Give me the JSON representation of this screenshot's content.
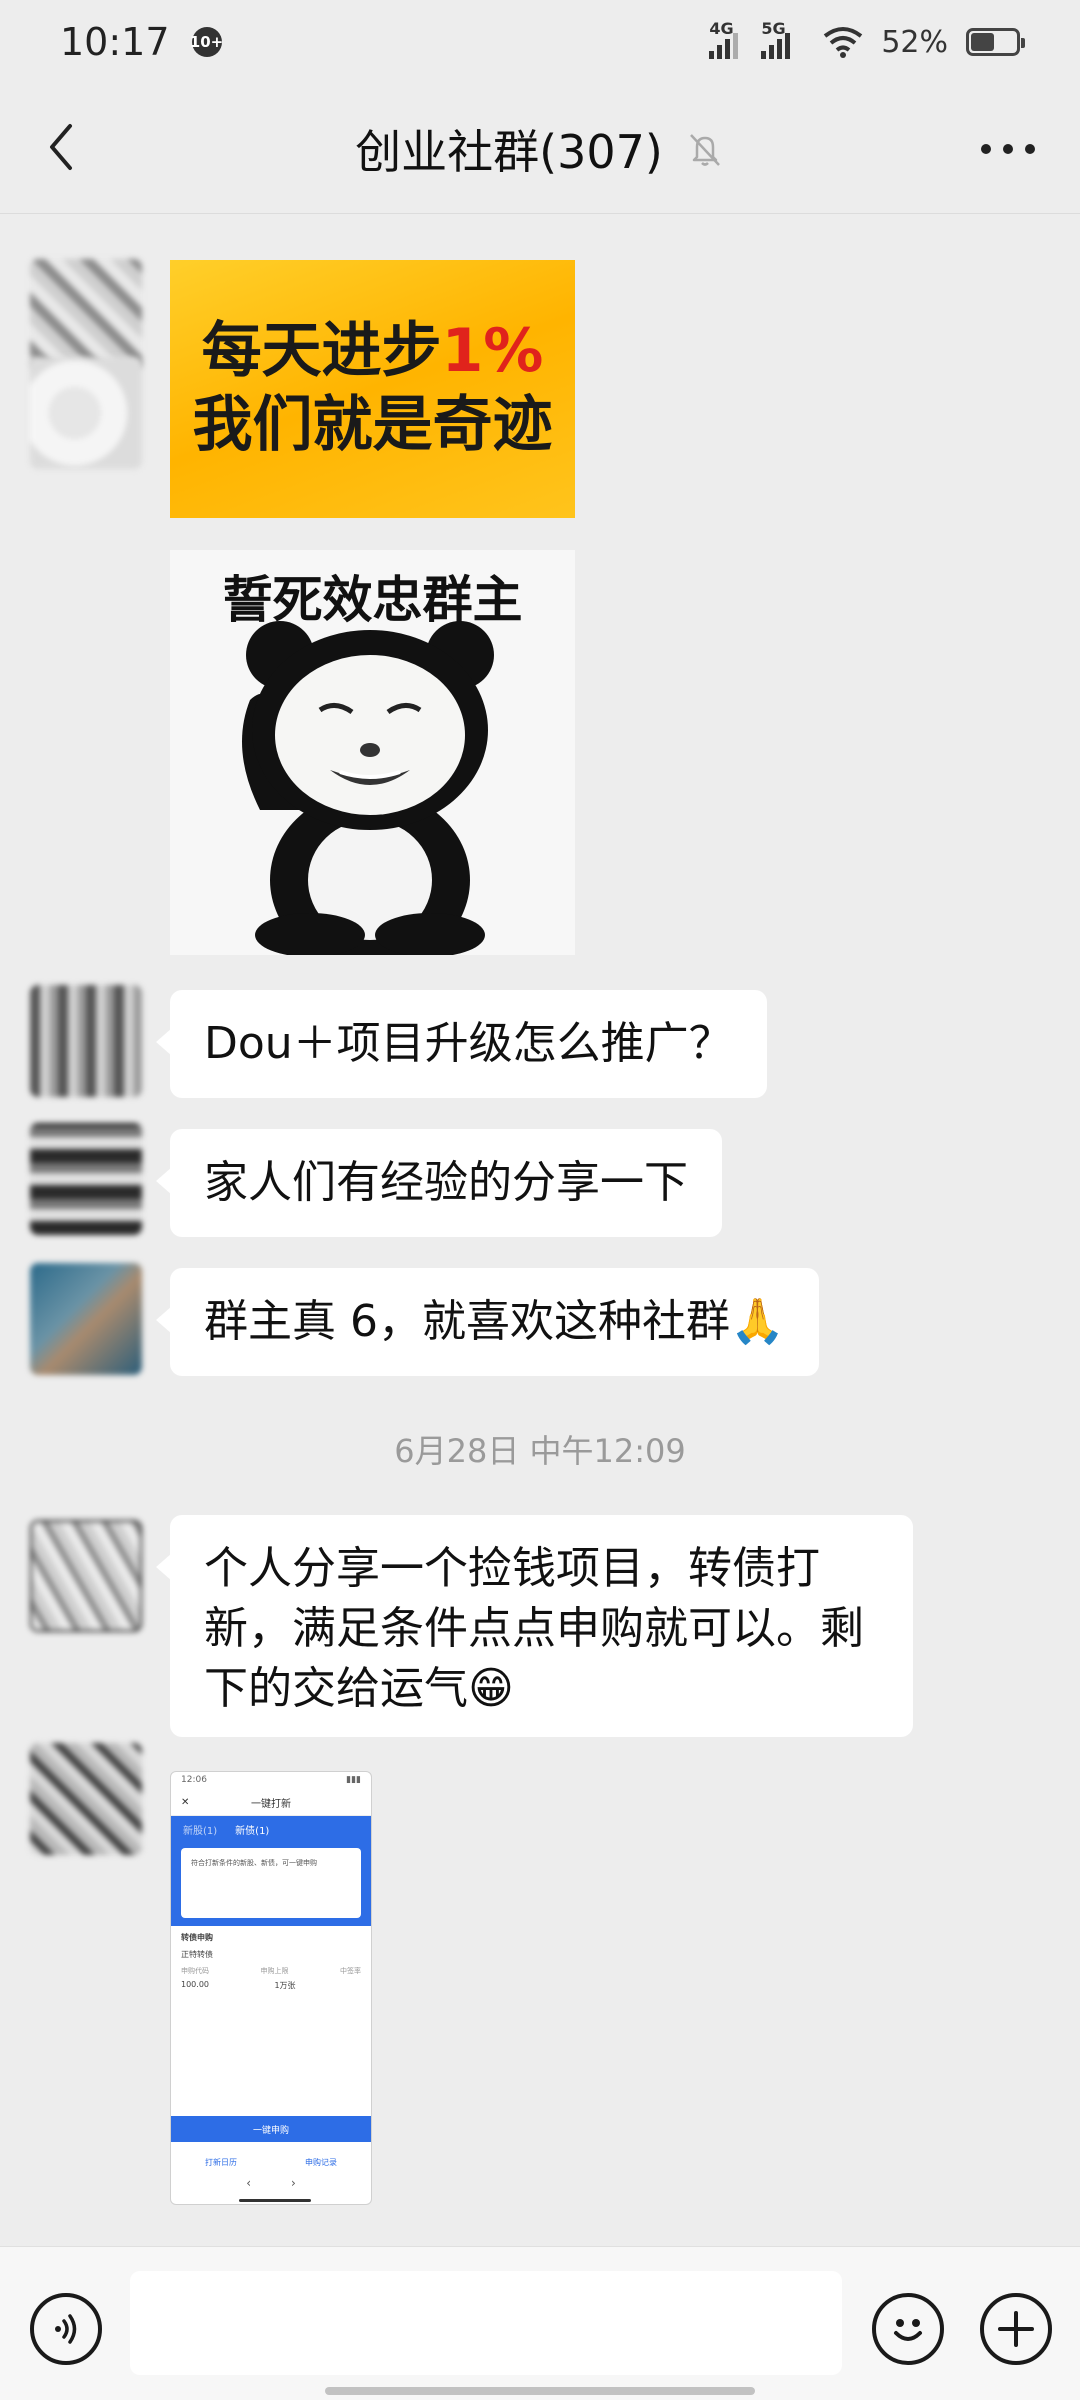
{
  "status_bar": {
    "time": "10:17",
    "notification_count": "10+",
    "net1": "4G",
    "net2": "5G",
    "battery_text": "52%",
    "battery_level": 0.52
  },
  "header": {
    "title": "创业社群(307)",
    "back_icon": "chevron-left-icon",
    "mute_icon": "bell-off-icon",
    "more_icon": "more-horizontal-icon"
  },
  "messages": {
    "sticker1": {
      "line1_main": "每天进步",
      "line1_accent": "1%",
      "line2": "我们就是奇迹",
      "accent_color": "#e0231c"
    },
    "sticker2": {
      "caption": "誓死效忠群主"
    },
    "text1": "Dou＋项目升级怎么推广？",
    "text2": "家人们有经验的分享一下",
    "text3": "群主真 6，就喜欢这种社群🙏",
    "timestamp": "6月28日  中午12:09",
    "text4": "个人分享一个捡钱项目，转债打新，满足条件点点申购就可以。剩下的交给运气😁",
    "screenshot": {
      "time": "12:06",
      "title": "一键打新",
      "tab1": "新股(1)",
      "tab2": "新债(1)",
      "card_text": "符合打新条件的新股、新债，可一键申购",
      "section": "转债申购",
      "stock_name": "正特转债",
      "col1": "申购代码",
      "col2": "申购上限",
      "col3": "中签率",
      "val1": "100.00",
      "val2": "1万张",
      "button": "一键申购",
      "foot1": "打新日历",
      "foot2": "申购记录"
    }
  },
  "input_bar": {
    "voice_icon": "voice-icon",
    "emoji_icon": "emoji-icon",
    "add_icon": "plus-icon",
    "placeholder": ""
  },
  "colors": {
    "background": "#ededed",
    "bubble": "#ffffff",
    "timestamp": "#9a9a9a"
  }
}
